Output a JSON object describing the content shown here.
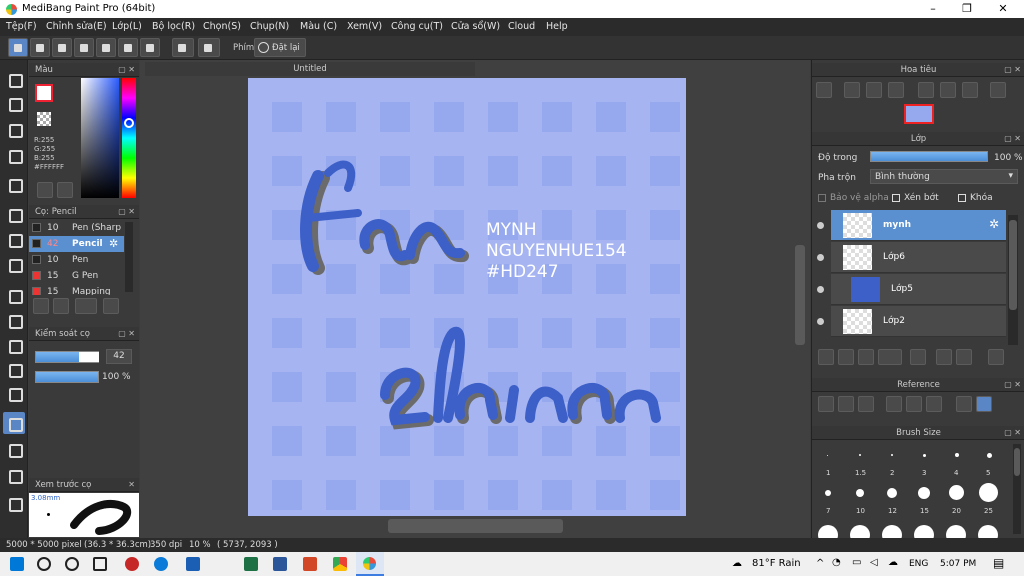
{
  "window": {
    "title": "MediBang Paint Pro (64bit)"
  },
  "menu": [
    "Tệp(F)",
    "Chỉnh sửa(E)",
    "Lớp(L)",
    "Bộ lọc(R)",
    "Chọn(S)",
    "Chụp(N)",
    "Màu (C)",
    "Xem(V)",
    "Công cụ(T)",
    "Cửa sổ(W)",
    "Cloud",
    "Help"
  ],
  "toolbar": {
    "hotkey_label": "Phím",
    "reset_label": "Đặt lại"
  },
  "color_panel": {
    "title": "Màu",
    "r": "R:255",
    "g": "G:255",
    "b": "B:255",
    "hex": "#FFFFFF"
  },
  "brush_panel": {
    "title": "Cọ: Pencil",
    "items": [
      {
        "size": "10",
        "name": "Pen (Sharp"
      },
      {
        "size": "42",
        "name": "Pencil"
      },
      {
        "size": "10",
        "name": "Pen"
      },
      {
        "size": "15",
        "name": "G Pen"
      },
      {
        "size": "15",
        "name": "Mapping Pe"
      }
    ]
  },
  "brush_control": {
    "title": "Kiểm soát cọ",
    "size": "42",
    "opacity": "100 %"
  },
  "preview": {
    "title": "Xem trước cọ",
    "size": "3.08mm"
  },
  "document": {
    "tab": "Untitled",
    "text_line1": "MYNH",
    "text_line2": "NGUYENHUE154",
    "text_line3": "#HD247"
  },
  "navigator": {
    "title": "Hoa tiêu"
  },
  "layers": {
    "title": "Lớp",
    "opacity_label": "Độ trong",
    "opacity_value": "100 %",
    "blend_label": "Pha trộn",
    "blend_value": "Bình thường",
    "protect_alpha": "Bảo vệ alpha",
    "clipping": "Xén bớt",
    "lock": "Khóa",
    "items": [
      "mynh",
      "Lớp6",
      "Lớp5",
      "Lớp2"
    ]
  },
  "reference": {
    "title": "Reference"
  },
  "brush_size": {
    "title": "Brush Size",
    "labels_row1": [
      "1",
      "1.5",
      "2",
      "3",
      "4",
      "5"
    ],
    "labels_row2": [
      "7",
      "10",
      "12",
      "15",
      "20",
      "25"
    ]
  },
  "status": {
    "dims": "5000 * 5000 pixel",
    "mm": "(36.3 * 36.3cm)",
    "dpi": "350 dpi",
    "zoom": "10 %",
    "coords": "( 5737, 2093 )"
  },
  "taskbar": {
    "weather": "81°F  Rain",
    "lang": "ENG",
    "time": "5:07 PM"
  }
}
